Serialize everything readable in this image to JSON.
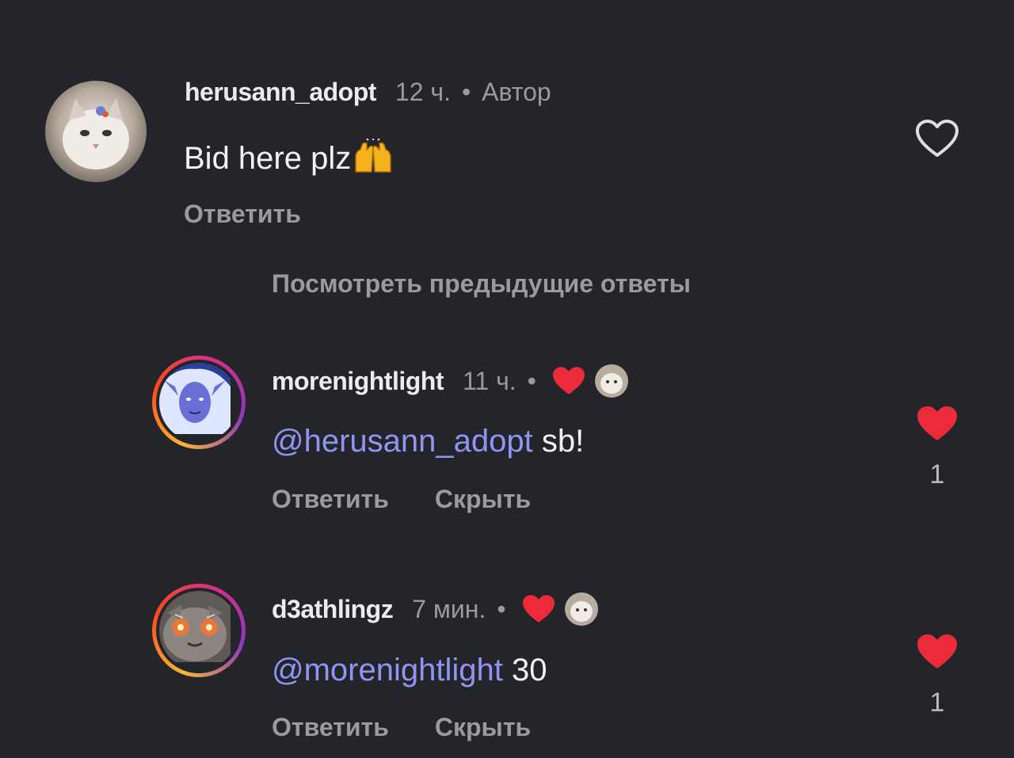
{
  "comments": [
    {
      "username": "herusann_adopt",
      "time": "12 ч.",
      "separator": "•",
      "badge": "Автор",
      "text": "Bid here plz",
      "emoji": "raising-hands-icon",
      "reply_label": "Ответить",
      "liked": false
    }
  ],
  "view_previous_label": "Посмотреть предыдущие ответы",
  "replies": [
    {
      "username": "morenightlight",
      "time": "11 ч.",
      "separator": "•",
      "mention": "@herusann_adopt",
      "text": " sb!",
      "reply_label": "Ответить",
      "hide_label": "Скрыть",
      "liked": true,
      "like_count": "1",
      "author_liked_icon": "heart-icon"
    },
    {
      "username": "d3athlingz",
      "time": "7 мин.",
      "separator": "•",
      "mention": "@morenightlight",
      "text": " 30",
      "reply_label": "Ответить",
      "hide_label": "Скрыть",
      "liked": true,
      "like_count": "1",
      "author_liked_icon": "heart-icon"
    }
  ],
  "colors": {
    "background": "#24252a",
    "mention": "#8f95f0",
    "heart": "#ed2a3a",
    "muted": "#9a9aa0"
  }
}
